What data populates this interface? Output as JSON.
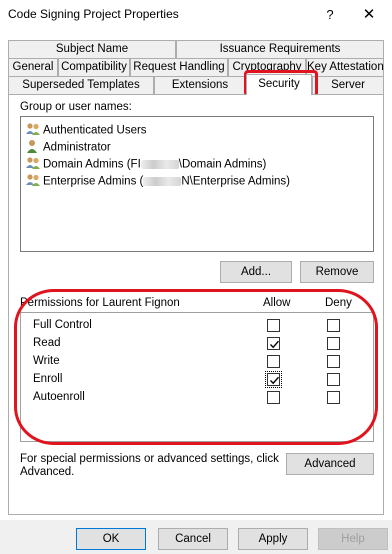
{
  "window": {
    "title": "Code Signing Project Properties",
    "help_label": "?",
    "close_label": "✕"
  },
  "tabs": {
    "row1": [
      "Subject Name",
      "Issuance Requirements"
    ],
    "row2": [
      "General",
      "Compatibility",
      "Request Handling",
      "Cryptography",
      "Key Attestation"
    ],
    "row3": [
      "Superseded Templates",
      "Extensions",
      "Security",
      "Server"
    ],
    "selected": "Security"
  },
  "security": {
    "group_label": "Group or user names:",
    "users": [
      {
        "name": "Authenticated Users",
        "icon": "users-group-icon"
      },
      {
        "name": "Administrator",
        "icon": "user-icon"
      },
      {
        "name_prefix": "Domain Admins (FI",
        "name_suffix": "\\Domain Admins)",
        "icon": "users-group-icon"
      },
      {
        "name_prefix": "Enterprise Admins (",
        "name_suffix": "N\\Enterprise Admins)",
        "icon": "users-group-icon"
      }
    ],
    "add_label": "Add...",
    "remove_label": "Remove",
    "permissions_label": "Permissions for Laurent Fignon",
    "allow_label": "Allow",
    "deny_label": "Deny",
    "permissions": [
      {
        "name": "Full Control",
        "allow": false,
        "deny": false
      },
      {
        "name": "Read",
        "allow": true,
        "deny": false
      },
      {
        "name": "Write",
        "allow": false,
        "deny": false
      },
      {
        "name": "Enroll",
        "allow": true,
        "deny": false
      },
      {
        "name": "Autoenroll",
        "allow": false,
        "deny": false
      }
    ],
    "special_text_line1": "For special permissions or advanced settings, click",
    "special_text_line2": "Advanced.",
    "advanced_label": "Advanced"
  },
  "footer": {
    "ok_label": "OK",
    "cancel_label": "Cancel",
    "apply_label": "Apply",
    "help_label": "Help"
  },
  "colors": {
    "annotation_red": "#e0141e",
    "default_button_border": "#0078d7"
  }
}
